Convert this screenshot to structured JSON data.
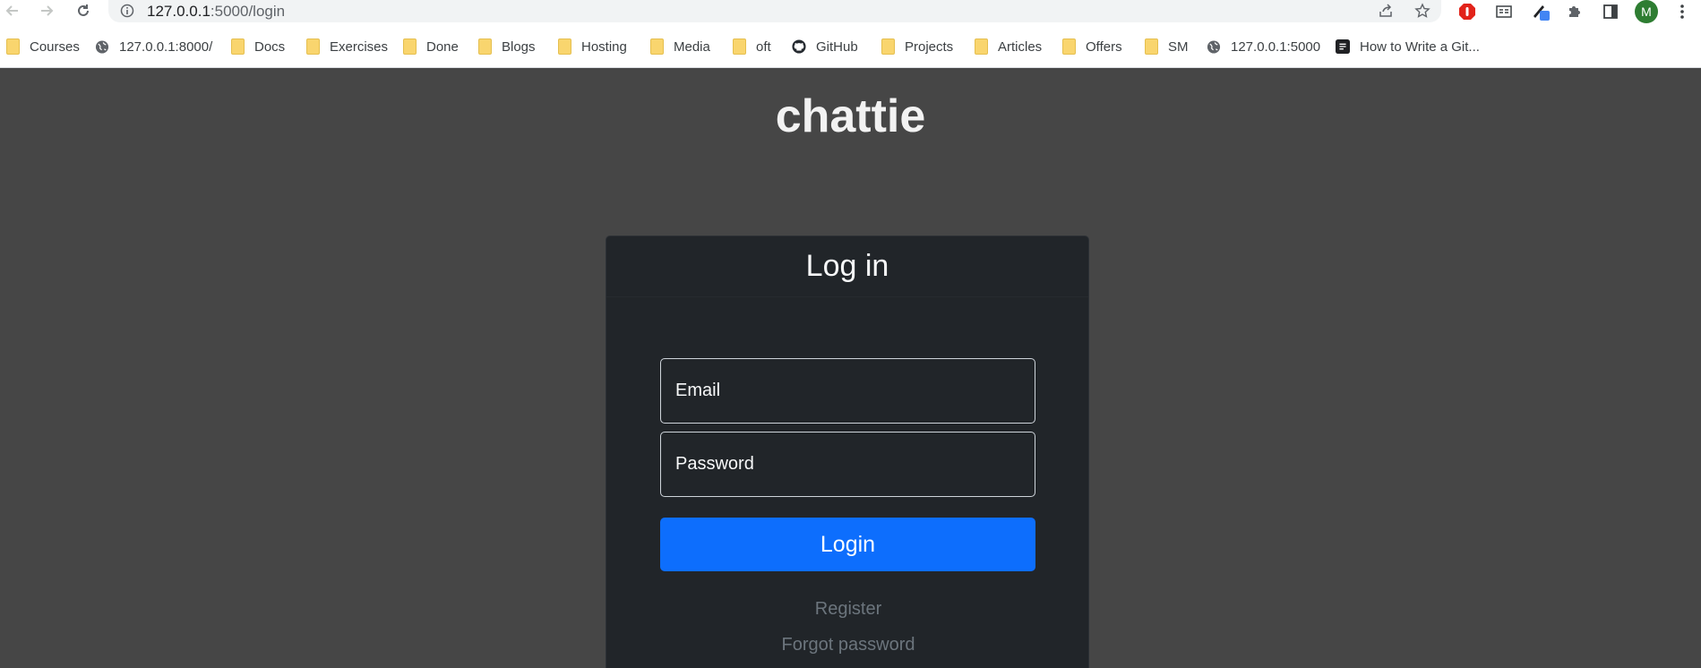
{
  "browser": {
    "url_host": "127.0.0.1",
    "url_path": ":5000/login",
    "profile_initial": "M"
  },
  "bookmarks": [
    {
      "label": "Courses",
      "icon": "folder-icon"
    },
    {
      "label": "127.0.0.1:8000/",
      "icon": "globe-icon"
    },
    {
      "label": "Docs",
      "icon": "folder-icon"
    },
    {
      "label": "Exercises",
      "icon": "folder-icon"
    },
    {
      "label": "Done",
      "icon": "folder-icon"
    },
    {
      "label": "Blogs",
      "icon": "folder-icon"
    },
    {
      "label": "Hosting",
      "icon": "folder-icon"
    },
    {
      "label": "Media",
      "icon": "folder-icon"
    },
    {
      "label": "oft",
      "icon": "folder-icon"
    },
    {
      "label": "GitHub",
      "icon": "github-icon"
    },
    {
      "label": "Projects",
      "icon": "folder-icon"
    },
    {
      "label": "Articles",
      "icon": "folder-icon"
    },
    {
      "label": "Offers",
      "icon": "folder-icon"
    },
    {
      "label": "SM",
      "icon": "folder-icon"
    },
    {
      "label": "127.0.0.1:5000",
      "icon": "globe-icon"
    },
    {
      "label": "How to Write a Git...",
      "icon": "doc-icon"
    }
  ],
  "page": {
    "brand": "chattie",
    "card_title": "Log in",
    "email_placeholder": "Email",
    "password_placeholder": "Password",
    "login_label": "Login",
    "register_label": "Register",
    "forgot_label": "Forgot password"
  },
  "colors": {
    "page_bg": "#464646",
    "card_bg": "#212529",
    "primary": "#0d6efd",
    "muted_link": "#6c757d"
  }
}
